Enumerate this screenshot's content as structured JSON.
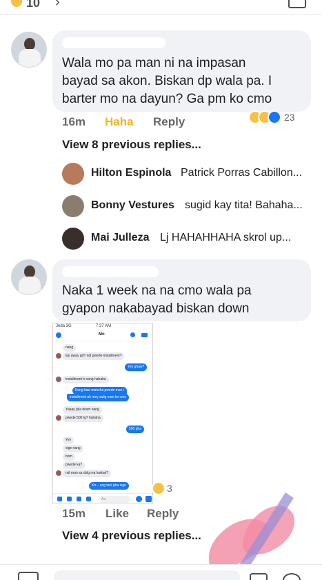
{
  "top": {
    "reaction_count": "10"
  },
  "comments": [
    {
      "text_lines": [
        "Wala mo pa man ni na impasan",
        "bayad sa akon. Biskan dp wala pa. I",
        "barter mo na dayun? Ga pm ko cmo"
      ],
      "time": "16m",
      "reaction_label": "Haha",
      "reply_label": "Reply",
      "reaction_total": "23",
      "view_previous": "View 8 previous replies...",
      "replies": [
        {
          "name": "Hilton Espinola",
          "snippet": "Patrick Porras Cabillon..."
        },
        {
          "name": "Bonny Vestures",
          "snippet": "sugid kay tita! Bahaha..."
        },
        {
          "name": "Mai Julleza",
          "snippet": "Lj HAHAHHAHA skrol up..."
        }
      ]
    },
    {
      "text_lines": [
        "Naka 1 week na na cmo wala pa",
        "gyapon nakabayad biskan down"
      ],
      "time": "15m",
      "like_label": "Like",
      "reply_label": "Reply",
      "reaction_total": "3",
      "view_previous": "View 4 previous replies..."
    }
  ],
  "screenshot": {
    "status_left": "Jeda 3G",
    "status_time": "7:37 AM",
    "title": "Mo",
    "messages": [
      {
        "side": "in",
        "text": "nang"
      },
      {
        "side": "in",
        "text": "lay away gd? ndi pwede installment?"
      },
      {
        "side": "out",
        "text": "Yes ghaw?"
      },
      {
        "side": "in",
        "text": "installment b nang hahaha"
      },
      {
        "side": "out",
        "text": "Kung kaw mancha pwede man i"
      },
      {
        "side": "out",
        "text": "installment ah mey sulig man ko cmo"
      },
      {
        "side": "in",
        "text": "Yaaay pila down nang"
      },
      {
        "side": "in",
        "text": "pwede 500 lg? hahaha"
      },
      {
        "side": "out",
        "text": "500 gha"
      },
      {
        "side": "in",
        "text": "Yey"
      },
      {
        "side": "in",
        "text": "sige nang"
      },
      {
        "side": "in",
        "text": "bom"
      },
      {
        "side": "in",
        "text": "pwede ka?"
      },
      {
        "side": "in",
        "text": "ndi man sa dslg ma lowbat?"
      },
      {
        "side": "out",
        "text": "Ko... ang tani gha sige"
      }
    ],
    "input_placeholder": "Aa"
  },
  "colors": {
    "bubble": "#f0f2f5",
    "haha": "#f0b429",
    "meta": "#65676b",
    "messenger_blue": "#1877f2"
  }
}
